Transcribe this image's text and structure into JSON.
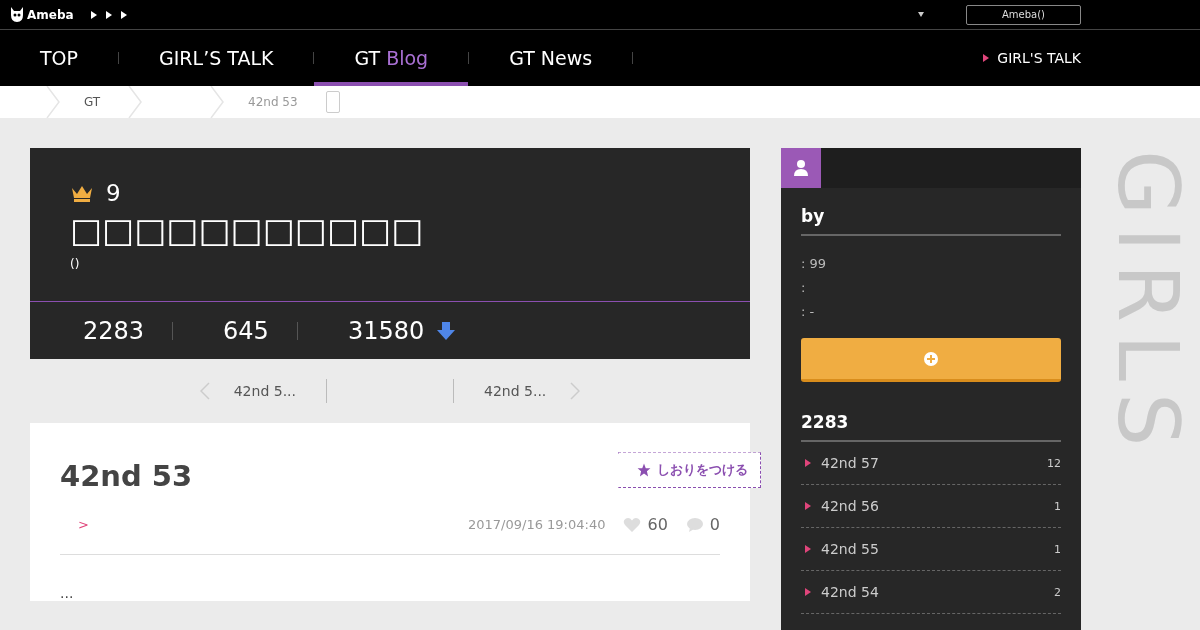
{
  "topbar": {
    "logo": "Ameba",
    "account_button": "Ameba()"
  },
  "nav": {
    "items": [
      {
        "label": "TOP",
        "selected": false
      },
      {
        "label": "GIRL’S TALK",
        "selected": false
      },
      {
        "label": "GT",
        "accent": "Blog",
        "selected": true
      },
      {
        "label": "GT News",
        "selected": false
      }
    ],
    "right_link": "GIRL'S TALK"
  },
  "breadcrumb": [
    "GT",
    "42nd 53"
  ],
  "blog": {
    "rank": "9",
    "title": "□□□□□□□□□□□",
    "subtitle": "()",
    "stats": [
      "2283",
      "645",
      "31580"
    ]
  },
  "pager": {
    "prev": "42nd 5...",
    "next": "42nd 5..."
  },
  "article": {
    "title": "42nd 53",
    "bookmark": "しおりをつける",
    "category": ">",
    "date": "2017/09/16 19:04:40",
    "likes": "60",
    "comments": "0",
    "body": "..."
  },
  "sidebar": {
    "heading": "by",
    "info": [
      ": 99",
      ":",
      ": -"
    ],
    "list_heading": "2283",
    "entries": [
      {
        "title": "42nd 57",
        "count": "12"
      },
      {
        "title": "42nd 56",
        "count": "1"
      },
      {
        "title": "42nd 55",
        "count": "1"
      },
      {
        "title": "42nd 54",
        "count": "2"
      }
    ]
  },
  "backdrop_text": "GIRLS"
}
